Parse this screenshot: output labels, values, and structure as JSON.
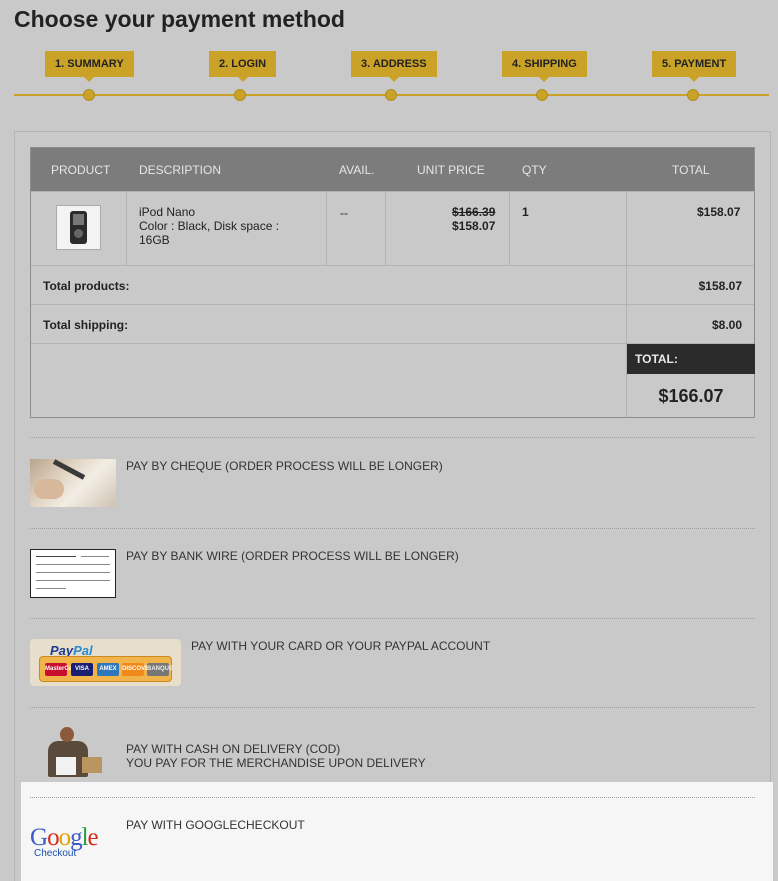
{
  "page": {
    "title": "Choose your payment method"
  },
  "steps": [
    {
      "label": "1. SUMMARY"
    },
    {
      "label": "2. LOGIN"
    },
    {
      "label": "3. ADDRESS"
    },
    {
      "label": "4. SHIPPING"
    },
    {
      "label": "5. PAYMENT"
    }
  ],
  "cart": {
    "headers": {
      "product": "PRODUCT",
      "description": "DESCRIPTION",
      "avail": "AVAIL.",
      "unit_price": "UNIT PRICE",
      "qty": "QTY",
      "total": "TOTAL"
    },
    "item": {
      "name": "iPod Nano",
      "attributes_line1": "Color : Black, Disk space :",
      "attributes_line2": "16GB",
      "avail": "--",
      "old_price": "$166.39",
      "price": "$158.07",
      "qty": "1",
      "total": "$158.07"
    },
    "total_products_label": "Total products:",
    "total_products_value": "$158.07",
    "total_shipping_label": "Total shipping:",
    "total_shipping_value": "$8.00",
    "grand_total_label": "TOTAL:",
    "grand_total_value": "$166.07"
  },
  "payment_options": {
    "cheque": "PAY BY CHEQUE (ORDER PROCESS WILL BE LONGER)",
    "bankwire": "PAY BY BANK WIRE (ORDER PROCESS WILL BE LONGER)",
    "paypal": "PAY WITH YOUR CARD OR YOUR PAYPAL ACCOUNT",
    "cod_line1": "PAY WITH CASH ON DELIVERY (COD)",
    "cod_line2": "YOU PAY FOR THE MERCHANDISE UPON DELIVERY",
    "google": "PAY WITH GOOGLECHECKOUT"
  },
  "logos": {
    "paypal_pay": "Pay",
    "paypal_pal": "Pal",
    "cards": [
      "MasterCard",
      "VISA",
      "AMEX",
      "DISCOVER",
      "BANQUE"
    ],
    "google_letters": [
      "G",
      "o",
      "o",
      "g",
      "l",
      "e"
    ],
    "google_sub": "Checkout"
  },
  "colors": {
    "accent": "#c9a227",
    "header_bg": "#7c7c7c",
    "total_bg": "#2b2b2b",
    "background": "#c9c9c9"
  }
}
